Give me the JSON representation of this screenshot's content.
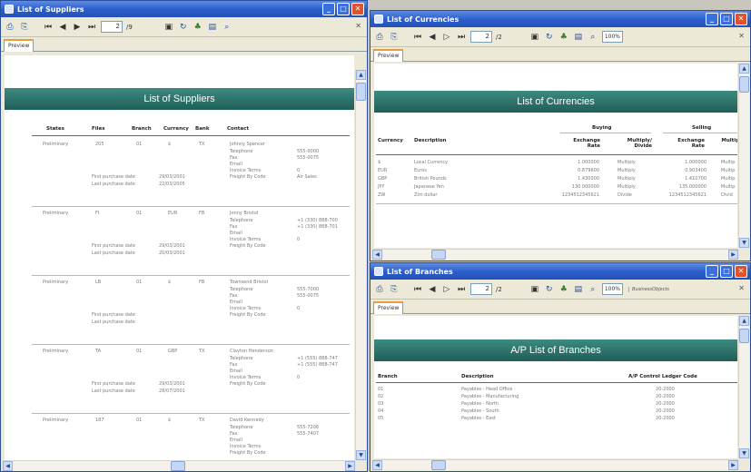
{
  "suppliers": {
    "title": "List of Suppliers",
    "page_current": "2",
    "page_total": "/9",
    "tab": "Preview",
    "report_title": "List of Suppliers",
    "columns": [
      "States",
      "Files",
      "Branch",
      "Currency",
      "Bank",
      "Contact"
    ],
    "contact_labels": [
      "Telephone",
      "Fax",
      "Email",
      "Invoice Terms",
      "Freight By Code"
    ],
    "date_labels": [
      "First purchase date",
      "Last purchase date"
    ],
    "rows": [
      {
        "state": "Preliminary",
        "file": "205",
        "branch": "01",
        "currency": "$",
        "bank": "TX",
        "contact": "Johnny Spencer",
        "tel": "555-0000",
        "fax": "555-0075",
        "terms": "0",
        "freight": "Air Sales",
        "first": "29/03/2001",
        "last": "22/03/2005"
      },
      {
        "state": "Preliminary",
        "file": "FI",
        "branch": "01",
        "currency": "EUR",
        "bank": "FB",
        "contact": "Jonny Bristol",
        "tel": "+1 (330) 888-700",
        "fax": "+1 (330) 888-701",
        "terms": "0",
        "freight": "",
        "first": "29/03/2001",
        "last": "20/03/2001"
      },
      {
        "state": "Preliminary",
        "file": "LB",
        "branch": "01",
        "currency": "$",
        "bank": "FB",
        "contact": "Townsend Bristol",
        "tel": "555-7000",
        "fax": "555-0075",
        "terms": "0",
        "freight": "",
        "first": "",
        "last": ""
      },
      {
        "state": "Preliminary",
        "file": "TA",
        "branch": "01",
        "currency": "GBP",
        "bank": "TX",
        "contact": "Clayton Henderson",
        "tel": "+1 (555) 888-747",
        "fax": "+1 (555) 888-747",
        "terms": "0",
        "freight": "",
        "first": "29/03/2001",
        "last": "28/07/2001"
      },
      {
        "state": "Preliminary",
        "file": "187",
        "branch": "01",
        "currency": "$",
        "bank": "TX",
        "contact": "David Kennedy",
        "tel": "555-7206",
        "fax": "555-7407",
        "terms": "",
        "freight": "",
        "first": "",
        "last": ""
      }
    ]
  },
  "currencies": {
    "title": "List of Currencies",
    "page_current": "2",
    "page_total": "/2",
    "zoom": "100%",
    "tab": "Preview",
    "report_title": "List of Currencies",
    "group_buying": "Buying",
    "group_selling": "Selling",
    "columns": [
      "Currency",
      "Description",
      "Exchange Rate",
      "Multiply/ Divide",
      "Exchange Rate",
      "Multip. Divid"
    ],
    "rows": [
      {
        "code": "$",
        "desc": "Local Currency",
        "buy_rate": "1.000000",
        "buy_md": "Multiply",
        "sell_rate": "1.000000",
        "sell_md": "Multip"
      },
      {
        "code": "EUR",
        "desc": "Euros",
        "buy_rate": "0.879600",
        "buy_md": "Multiply",
        "sell_rate": "0.903400",
        "sell_md": "Multip"
      },
      {
        "code": "GBP",
        "desc": "British Pounds",
        "buy_rate": "1.430000",
        "buy_md": "Multiply",
        "sell_rate": "1.410700",
        "sell_md": "Multip"
      },
      {
        "code": "JPY",
        "desc": "Japanese Yen",
        "buy_rate": "130.000000",
        "buy_md": "Multiply",
        "sell_rate": "135.000000",
        "sell_md": "Multip"
      },
      {
        "code": "ZW",
        "desc": "Zim dollar",
        "buy_rate": "1234512345621",
        "buy_md": "Divide",
        "sell_rate": "1234512345621",
        "sell_md": "Divid"
      }
    ]
  },
  "branches": {
    "title": "List of Branches",
    "page_current": "2",
    "page_total": "/2",
    "zoom": "100%",
    "logo": "BusinessObjects",
    "tab": "Preview",
    "report_title": "A/P List of Branches",
    "columns": [
      "Branch",
      "Description",
      "A/P Control Ledger Code"
    ],
    "rows": [
      {
        "branch": "01",
        "desc": "Payables - Head Office",
        "code": "20-2000"
      },
      {
        "branch": "02",
        "desc": "Payables - Manufacturing",
        "code": "20-2000"
      },
      {
        "branch": "03",
        "desc": "Payables - North",
        "code": "20-2000"
      },
      {
        "branch": "04",
        "desc": "Payables - South",
        "code": "20-2000"
      },
      {
        "branch": "05",
        "desc": "Payables - East",
        "code": "20-2000"
      }
    ]
  }
}
